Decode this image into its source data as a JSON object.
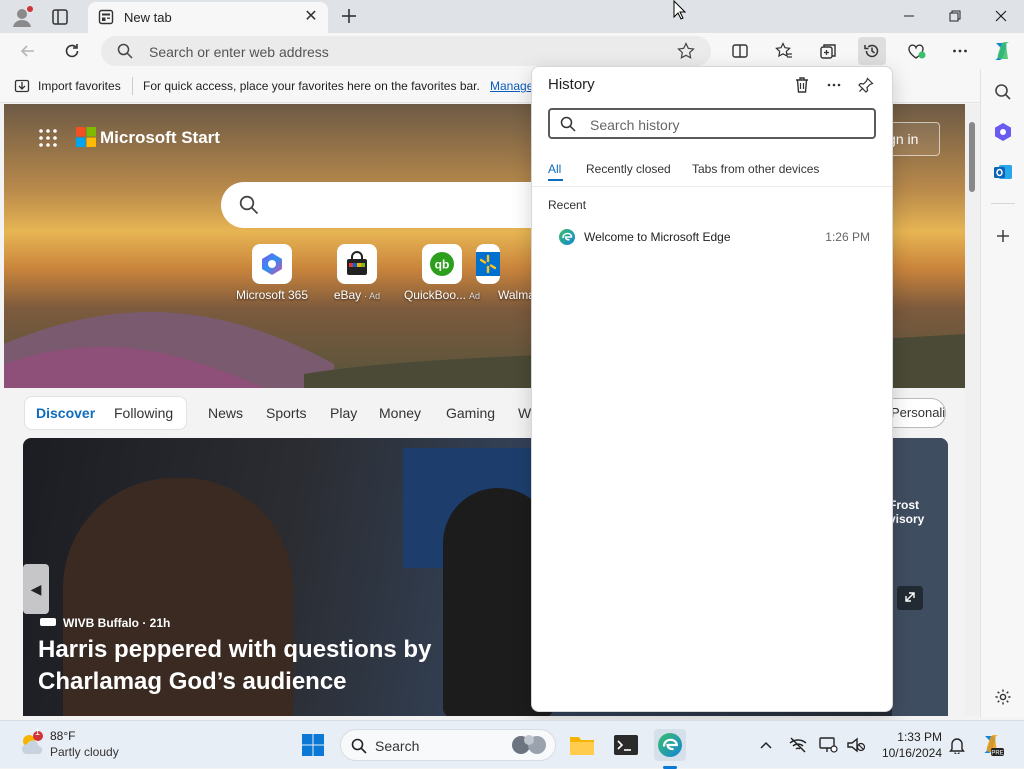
{
  "browser": {
    "tab_title": "New tab",
    "address_placeholder": "Search or enter web address"
  },
  "favorites_bar": {
    "import_label": "Import favorites",
    "message": "For quick access, place your favorites here on the favorites bar.",
    "manage_link": "Manage"
  },
  "start_page": {
    "brand": "Microsoft Start",
    "sign_in": "Sign in",
    "quick_links": [
      {
        "label": "Microsoft 365",
        "ad": ""
      },
      {
        "label": "eBay",
        "ad": "· Ad"
      },
      {
        "label": "QuickBoo...",
        "ad": "Ad"
      },
      {
        "label": "Walma",
        "ad": ""
      }
    ],
    "feed_tabs": {
      "discover": "Discover",
      "following": "Following",
      "news": "News",
      "sports": "Sports",
      "play": "Play",
      "money": "Money",
      "gaming": "Gaming",
      "more": "W"
    },
    "personalize": "Personalize",
    "article": {
      "source": "WIVB Buffalo · 21h",
      "headline": "Harris peppered with questions by Charlamag God’s audience",
      "side_card": "Frost\nvisory"
    }
  },
  "history_panel": {
    "title": "History",
    "search_placeholder": "Search history",
    "tabs": [
      "All",
      "Recently closed",
      "Tabs from other devices"
    ],
    "section": "Recent",
    "items": [
      {
        "title": "Welcome to Microsoft Edge",
        "time": "1:26 PM"
      }
    ]
  },
  "taskbar": {
    "weather_temp": "88°F",
    "weather_desc": "Partly cloudy",
    "weather_badge": "1",
    "search_label": "Search",
    "time": "1:33 PM",
    "date": "10/16/2024"
  },
  "colors": {
    "accent": "#0f6cbd",
    "edge_blue": "#1384d7",
    "edge_green": "#3cbf6a"
  }
}
